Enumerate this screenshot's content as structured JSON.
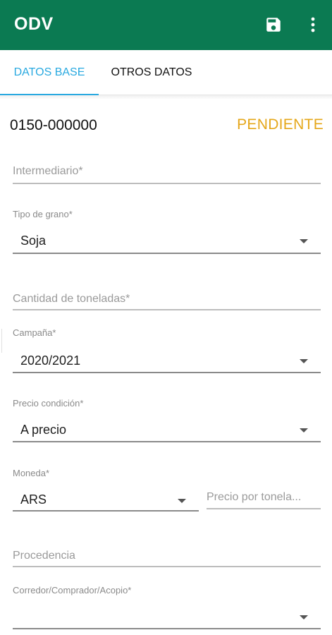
{
  "app_bar": {
    "title": "ODV",
    "save_icon": "floppy-disk-icon",
    "more_icon": "more-vertical-icon",
    "background": "#0b7a52"
  },
  "tabs": [
    {
      "label": "DATOS BASE",
      "active": true
    },
    {
      "label": "OTROS DATOS",
      "active": false
    }
  ],
  "header": {
    "number": "0150-000000",
    "status": "PENDIENTE",
    "status_color": "#e5a71a"
  },
  "form": {
    "intermediario": {
      "label": "Intermediario*"
    },
    "tipo_grano": {
      "label": "Tipo de grano*",
      "value": "Soja"
    },
    "cantidad": {
      "label": "Cantidad de toneladas*"
    },
    "campana": {
      "label": "Campaña*",
      "value": "2020/2021"
    },
    "precio_condicion": {
      "label": "Precio condición*",
      "value": "A precio"
    },
    "moneda": {
      "label": "Moneda*",
      "value": "ARS"
    },
    "precio_tonelada": {
      "label": "Precio por tonela..."
    },
    "procedencia": {
      "label": "Procedencia"
    },
    "corredor": {
      "label": "Corredor/Comprador/Acopio*",
      "value": ""
    }
  }
}
